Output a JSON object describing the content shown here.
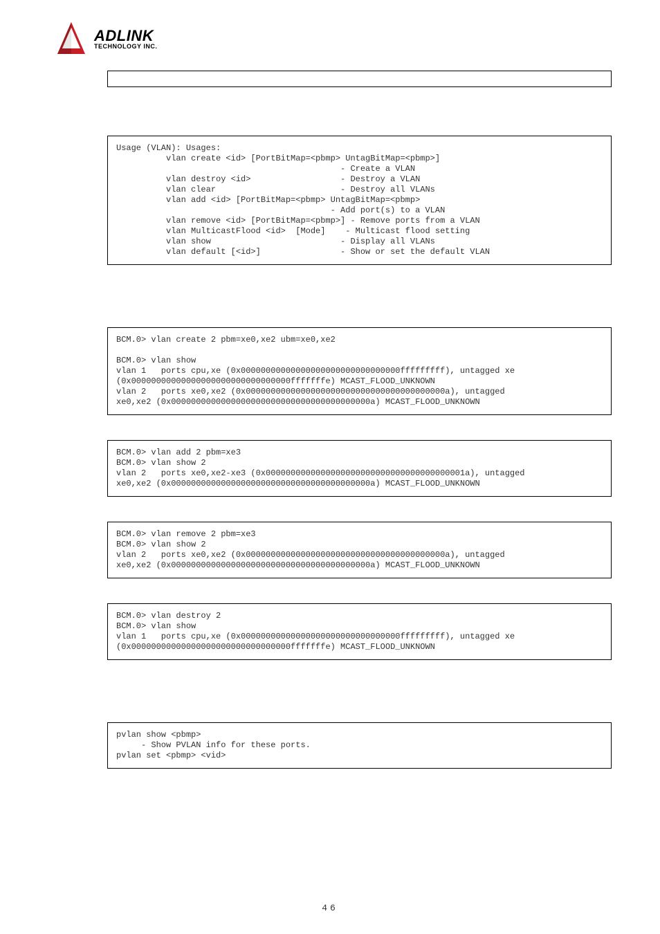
{
  "logo": {
    "brand": "ADLINK",
    "sub": "TECHNOLOGY INC."
  },
  "boxes": {
    "usage": "Usage (VLAN): Usages:\n          vlan create <id> [PortBitMap=<pbmp> UntagBitMap=<pbmp>]\n                                             - Create a VLAN\n          vlan destroy <id>                  - Destroy a VLAN\n          vlan clear                         - Destroy all VLANs\n          vlan add <id> [PortBitMap=<pbmp> UntagBitMap=<pbmp>\n                                           - Add port(s) to a VLAN\n          vlan remove <id> [PortBitMap=<pbmp>] - Remove ports from a VLAN\n          vlan MulticastFlood <id>  [Mode]    - Multicast flood setting\n          vlan show                          - Display all VLANs\n          vlan default [<id>]                - Show or set the default VLAN",
    "create": "BCM.0> vlan create 2 pbm=xe0,xe2 ubm=xe0,xe2\n\nBCM.0> vlan show\nvlan 1   ports cpu,xe (0x00000000000000000000000000000000fffffffff), untagged xe\n(0x00000000000000000000000000000000fffffffe) MCAST_FLOOD_UNKNOWN\nvlan 2   ports xe0,xe2 (0x0000000000000000000000000000000000000000a), untagged\nxe0,xe2 (0x0000000000000000000000000000000000000000a) MCAST_FLOOD_UNKNOWN",
    "add": "BCM.0> vlan add 2 pbm=xe3\nBCM.0> vlan show 2\nvlan 2   ports xe0,xe2-xe3 (0x0000000000000000000000000000000000000001a), untagged\nxe0,xe2 (0x0000000000000000000000000000000000000000a) MCAST_FLOOD_UNKNOWN",
    "remove": "BCM.0> vlan remove 2 pbm=xe3\nBCM.0> vlan show 2\nvlan 2   ports xe0,xe2 (0x0000000000000000000000000000000000000000a), untagged\nxe0,xe2 (0x0000000000000000000000000000000000000000a) MCAST_FLOOD_UNKNOWN",
    "destroy": "BCM.0> vlan destroy 2\nBCM.0> vlan show\nvlan 1   ports cpu,xe (0x00000000000000000000000000000000fffffffff), untagged xe\n(0x00000000000000000000000000000000fffffffe) MCAST_FLOOD_UNKNOWN",
    "pvlan": "pvlan show <pbmp>\n     - Show PVLAN info for these ports.\npvlan set <pbmp> <vid>"
  },
  "page_number": "46"
}
